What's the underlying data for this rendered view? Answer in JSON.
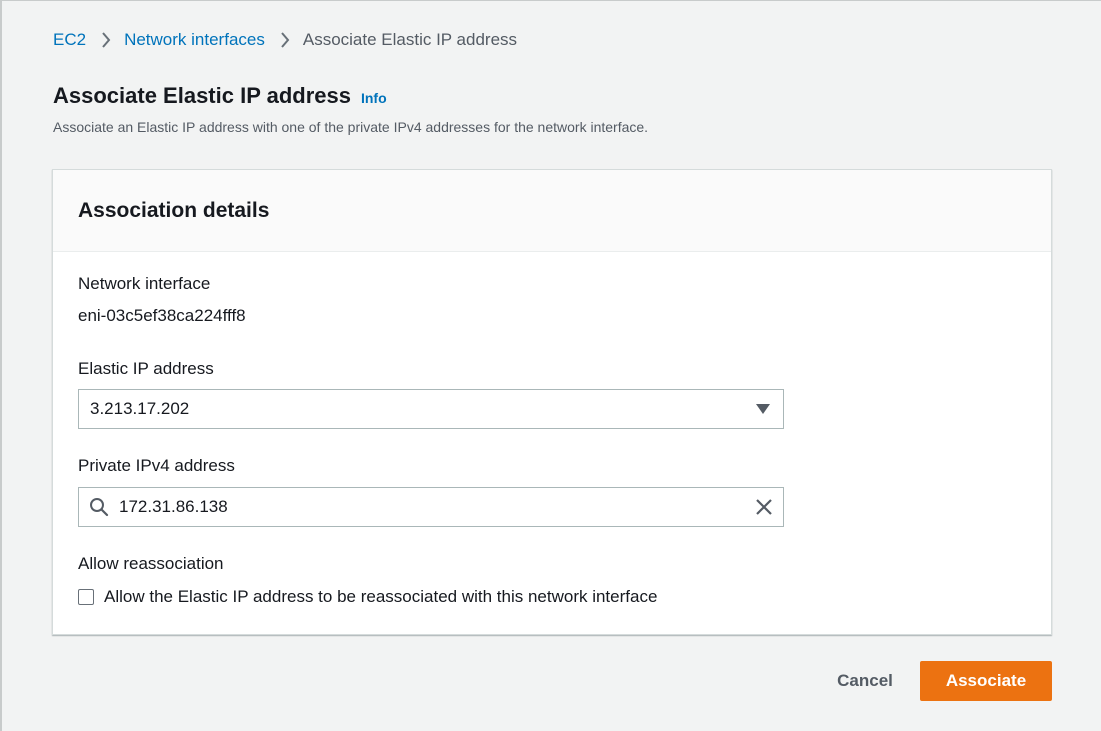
{
  "breadcrumb": {
    "items": [
      {
        "label": "EC2",
        "link": true
      },
      {
        "label": "Network interfaces",
        "link": true
      },
      {
        "label": "Associate Elastic IP address",
        "link": false
      }
    ]
  },
  "header": {
    "title": "Associate Elastic IP address",
    "info_label": "Info",
    "description": "Associate an Elastic IP address with one of the private IPv4 addresses for the network interface."
  },
  "panel": {
    "title": "Association details",
    "network_interface": {
      "label": "Network interface",
      "value": "eni-03c5ef38ca224fff8"
    },
    "elastic_ip": {
      "label": "Elastic IP address",
      "selected": "3.213.17.202"
    },
    "private_ipv4": {
      "label": "Private IPv4 address",
      "value": "172.31.86.138"
    },
    "reassociation": {
      "label": "Allow reassociation",
      "checkbox_label": "Allow the Elastic IP address to be reassociated with this network interface",
      "checked": false
    }
  },
  "actions": {
    "cancel_label": "Cancel",
    "associate_label": "Associate"
  },
  "colors": {
    "link": "#0073bb",
    "primary_button": "#ec7211",
    "background": "#f2f3f3"
  },
  "icons": {
    "breadcrumb_separator": "chevron-right-icon",
    "select_caret": "caret-down-icon",
    "search": "search-icon",
    "clear": "close-icon"
  }
}
